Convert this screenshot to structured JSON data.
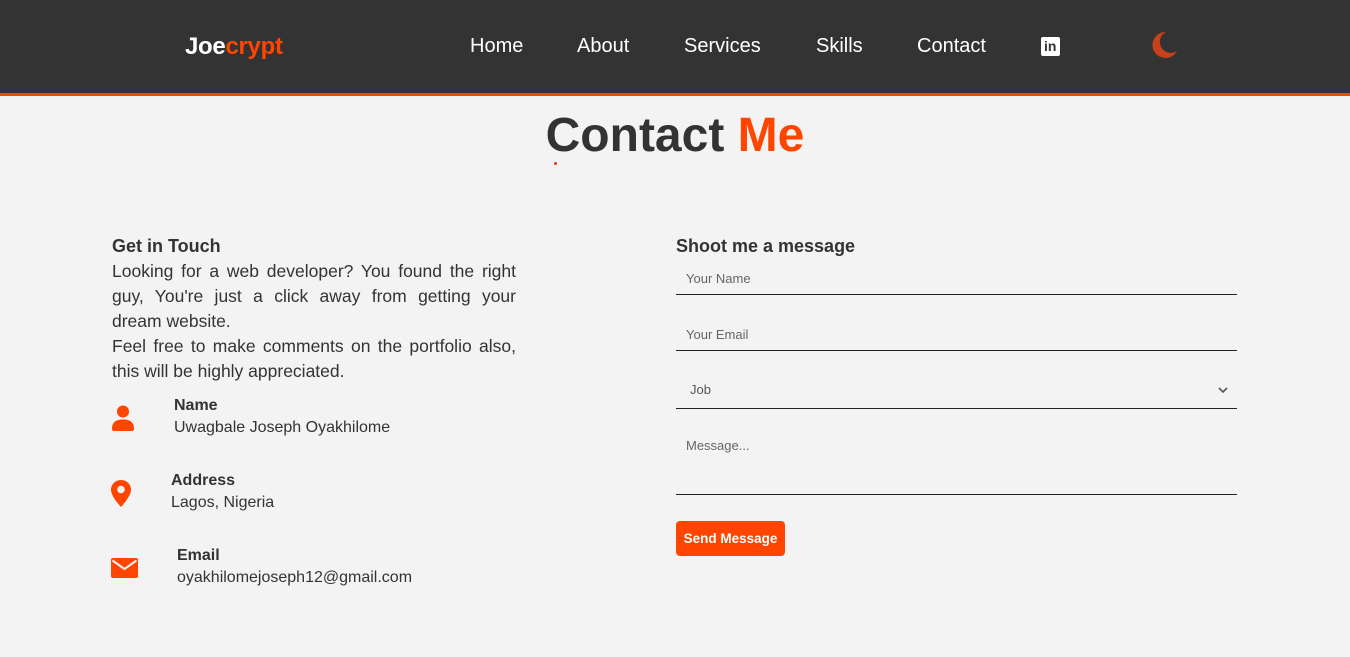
{
  "header": {
    "logo_main": "Joe",
    "logo_accent": "crypt",
    "nav": [
      "Home",
      "About",
      "Services",
      "Skills",
      "Contact"
    ],
    "linkedin_icon": "linkedin-icon",
    "theme_icon": "moon-icon",
    "accent_color": "#ff4500",
    "bg_color": "#333333"
  },
  "title": {
    "main": "Contact",
    "accent": "Me"
  },
  "contact_info": {
    "heading": "Get in Touch",
    "intro": "Looking for a web developer? You found the right guy, You're just a click away from getting your dream website.\nFeel free to make comments on the portfolio also, this will be highly appreciated.",
    "items": [
      {
        "label": "Name",
        "value": "Uwagbale Joseph Oyakhilome",
        "icon": "user-icon"
      },
      {
        "label": "Address",
        "value": "Lagos, Nigeria",
        "icon": "location-pin-icon"
      },
      {
        "label": "Email",
        "value": "oyakhilomejoseph12@gmail.com",
        "icon": "envelope-icon"
      }
    ]
  },
  "form": {
    "heading": "Shoot me a message",
    "name_placeholder": "Your Name",
    "email_placeholder": "Your Email",
    "job_selected": "Job",
    "message_placeholder": "Message...",
    "submit_label": "Send Message"
  }
}
